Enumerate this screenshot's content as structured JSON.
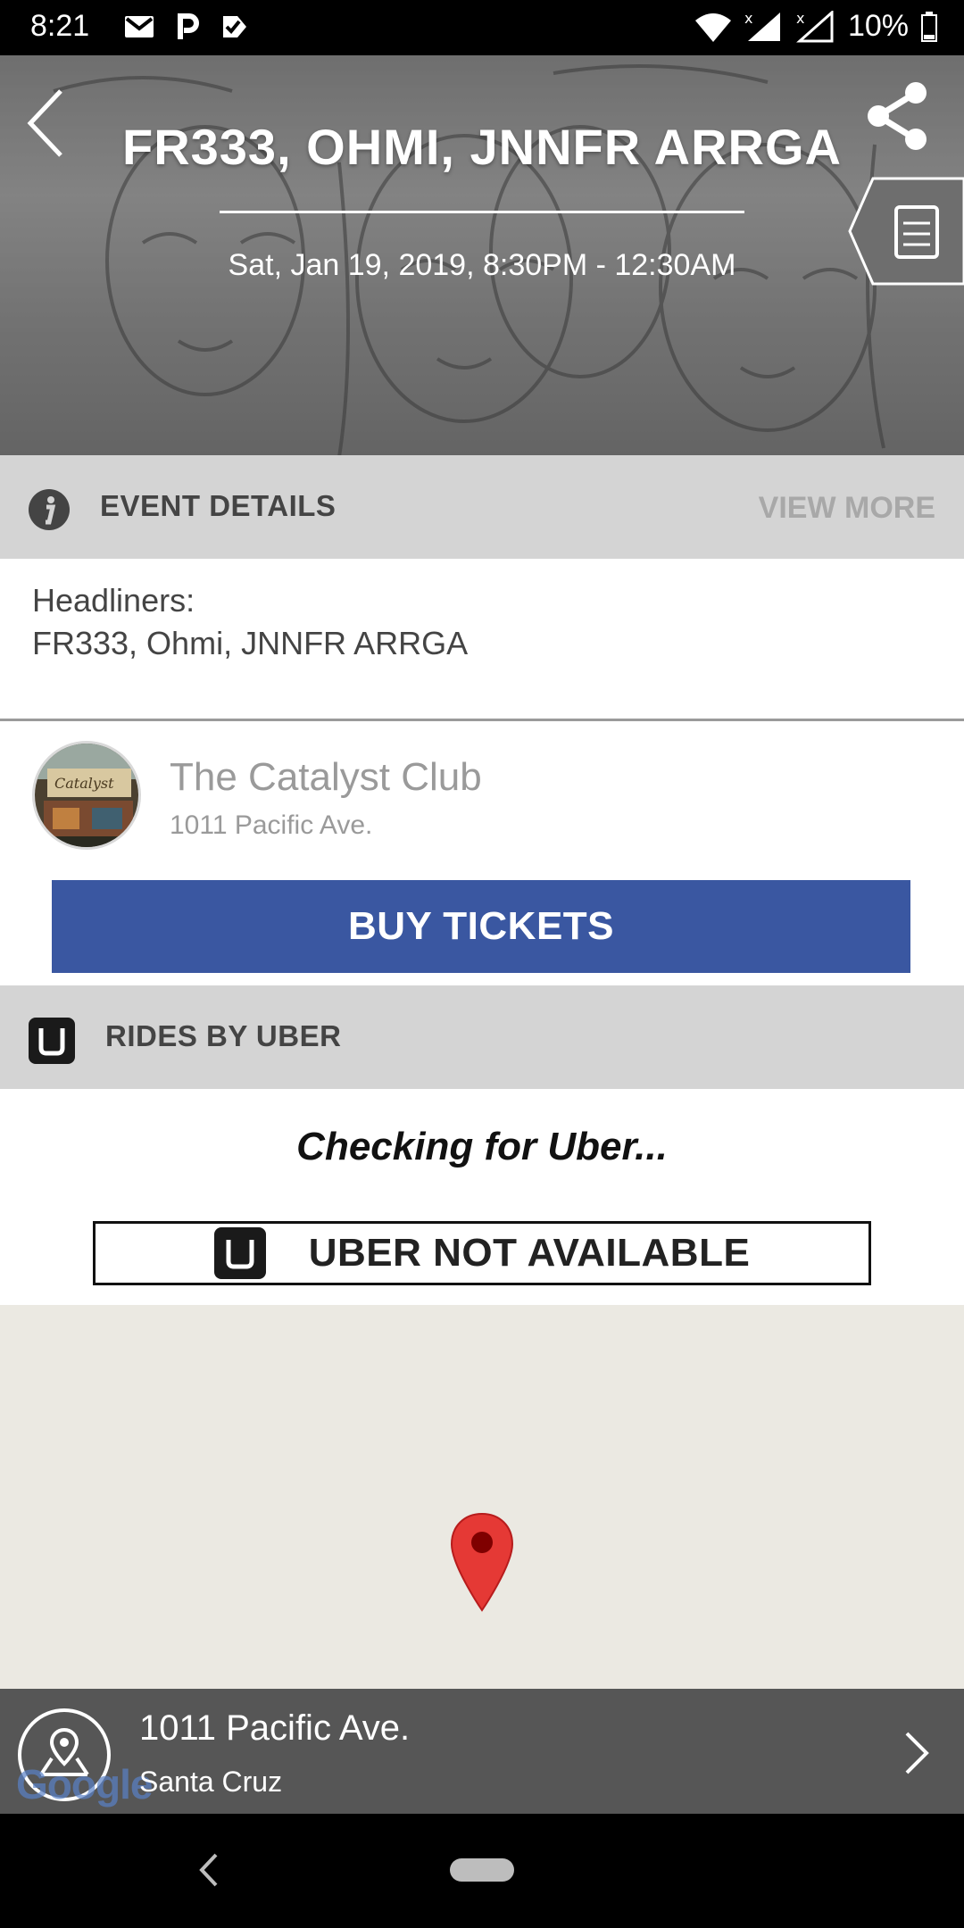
{
  "status_bar": {
    "time": "8:21",
    "battery": "10%"
  },
  "hero": {
    "title": "FR333, OHMI, JNNFR ARRGA",
    "date": "Sat, Jan 19, 2019, 8:30PM - 12:30AM"
  },
  "event_details": {
    "header": "EVENT DETAILS",
    "view_more": "VIEW MORE",
    "line1": "Headliners:",
    "line2": "FR333, Ohmi, JNNFR ARRGA"
  },
  "venue": {
    "name": "The Catalyst Club",
    "address": "1011 Pacific Ave.",
    "buy_label": "BUY TICKETS"
  },
  "uber": {
    "header": "RIDES BY UBER",
    "checking": "Checking for Uber...",
    "button": "UBER NOT AVAILABLE"
  },
  "map": {
    "address_line1": "1011 Pacific Ave.",
    "address_line2": "Santa Cruz",
    "attribution": "Google"
  },
  "colors": {
    "buy_button": "#3a57a1",
    "section_header": "#d4d4d4",
    "map_background": "#ebe9e2",
    "map_pin": "#e53935",
    "address_bar": "#565656"
  }
}
